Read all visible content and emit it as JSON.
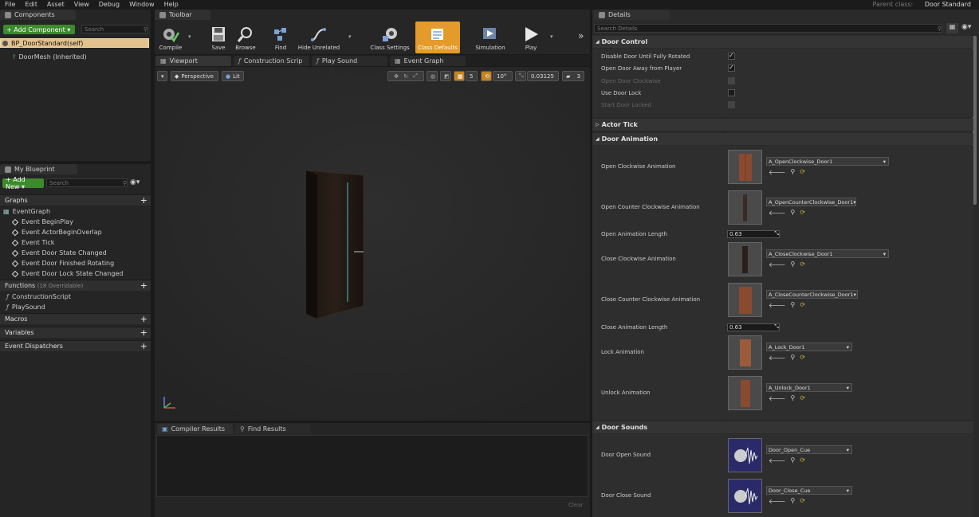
{
  "menu": [
    "File",
    "Edit",
    "Asset",
    "View",
    "Debug",
    "Window",
    "Help"
  ],
  "parent_class": {
    "label": "Parent class:",
    "value": "Door Standard"
  },
  "components": {
    "tab": "Components",
    "add_button": "+ Add Component ▾",
    "search_placeholder": "Search",
    "items": [
      "BP_DoorStandard(self)",
      "DoorMesh (Inherited)"
    ]
  },
  "my_blueprint": {
    "tab": "My Blueprint",
    "add_button": "+ Add New ▾",
    "search_placeholder": "Search",
    "graphs_label": "Graphs",
    "event_graph": "EventGraph",
    "events": [
      "Event BeginPlay",
      "Event ActorBeginOverlap",
      "Event Tick",
      "Event Door State Changed",
      "Event Door Finished Rotating",
      "Event Door Lock State Changed"
    ],
    "functions_label": "Functions",
    "functions_count": "(18 Overridable)",
    "functions": [
      "ConstructionScript",
      "PlaySound"
    ],
    "macros_label": "Macros",
    "variables_label": "Variables",
    "dispatchers_label": "Event Dispatchers"
  },
  "toolbar": {
    "tab": "Toolbar",
    "buttons": [
      "Compile",
      "Save",
      "Browse",
      "Find",
      "Hide Unrelated",
      "Class Settings",
      "Class Defaults",
      "Simulation",
      "Play"
    ]
  },
  "editor_tabs": [
    "Viewport",
    "Construction Scrip",
    "Play Sound",
    "Event Graph"
  ],
  "viewport": {
    "perspective": "Perspective",
    "lit": "Lit",
    "grid_value": "5",
    "angle_value": "10°",
    "scale_value": "0.03125",
    "speed_value": "3"
  },
  "bottom_tabs": [
    "Compiler Results",
    "Find Results"
  ],
  "clear_label": "Clear",
  "details": {
    "tab": "Details",
    "search_placeholder": "Search Details",
    "door_control": {
      "title": "Door Control",
      "rows": [
        {
          "label": "Disable Door Until Fully Rotated",
          "checked": true,
          "disabled": false
        },
        {
          "label": "Open Door Away from Player",
          "checked": true,
          "disabled": false
        },
        {
          "label": "Open Door Clockwise",
          "checked": false,
          "disabled": true
        },
        {
          "label": "Use Door Lock",
          "checked": false,
          "disabled": false
        },
        {
          "label": "Start Door Locked",
          "checked": false,
          "disabled": true
        }
      ]
    },
    "actor_tick": "Actor Tick",
    "door_animation": {
      "title": "Door Animation",
      "open_cw_label": "Open Clockwise Animation",
      "open_cw_asset": "A_OpenClockwise_Door1",
      "open_ccw_label": "Open Counter Clockwise Animation",
      "open_ccw_asset": "A_OpenCounterClockwise_Door1",
      "open_len_label": "Open Animation Length",
      "open_len_value": "0.63",
      "close_cw_label": "Close Clockwise Animation",
      "close_cw_asset": "A_CloseClockwise_Door1",
      "close_ccw_label": "Close Counter Clockwise Animation",
      "close_ccw_asset": "A_CloseCounterClockwise_Door1",
      "close_len_label": "Close Animation Length",
      "close_len_value": "0.63",
      "lock_label": "Lock Animation",
      "lock_asset": "A_Lock_Door1",
      "unlock_label": "Unlock Animation",
      "unlock_asset": "A_Unlock_Door1"
    },
    "door_sounds": {
      "title": "Door Sounds",
      "open_label": "Door Open Sound",
      "open_asset": "Door_Open_Cue",
      "close_label": "Door Close Sound",
      "close_asset": "Door_Close_Cue"
    }
  }
}
